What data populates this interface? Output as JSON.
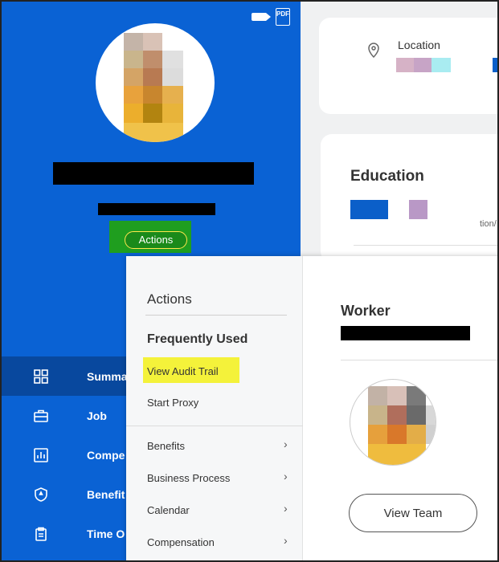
{
  "header": {
    "pdf_label": "PDF"
  },
  "profile": {
    "actions_label": "Actions"
  },
  "nav": {
    "items": [
      {
        "label": "Summa",
        "icon": "grid-icon"
      },
      {
        "label": "Job",
        "icon": "briefcase-icon"
      },
      {
        "label": "Compe",
        "icon": "chart-icon"
      },
      {
        "label": "Benefit",
        "icon": "shield-icon"
      },
      {
        "label": "Time O",
        "icon": "clipboard-icon"
      }
    ]
  },
  "cards": {
    "location_label": "Location",
    "education_title": "Education",
    "education_fragment": "tion/"
  },
  "menu": {
    "heading": "Actions",
    "frequently_used": "Frequently Used",
    "view_audit_trail": "View Audit Trail",
    "start_proxy": "Start Proxy",
    "submenus": [
      "Benefits",
      "Business Process",
      "Calendar",
      "Compensation"
    ]
  },
  "worker": {
    "title": "Worker",
    "view_team": "View Team",
    "cut1": "C",
    "cut2": "V",
    "cut3": "("
  },
  "colors": {
    "panel_blue": "#0a62d4",
    "nav_active": "#08489e",
    "highlight_yellow": "#f4f23a",
    "actions_green": "#1f9e1f"
  }
}
